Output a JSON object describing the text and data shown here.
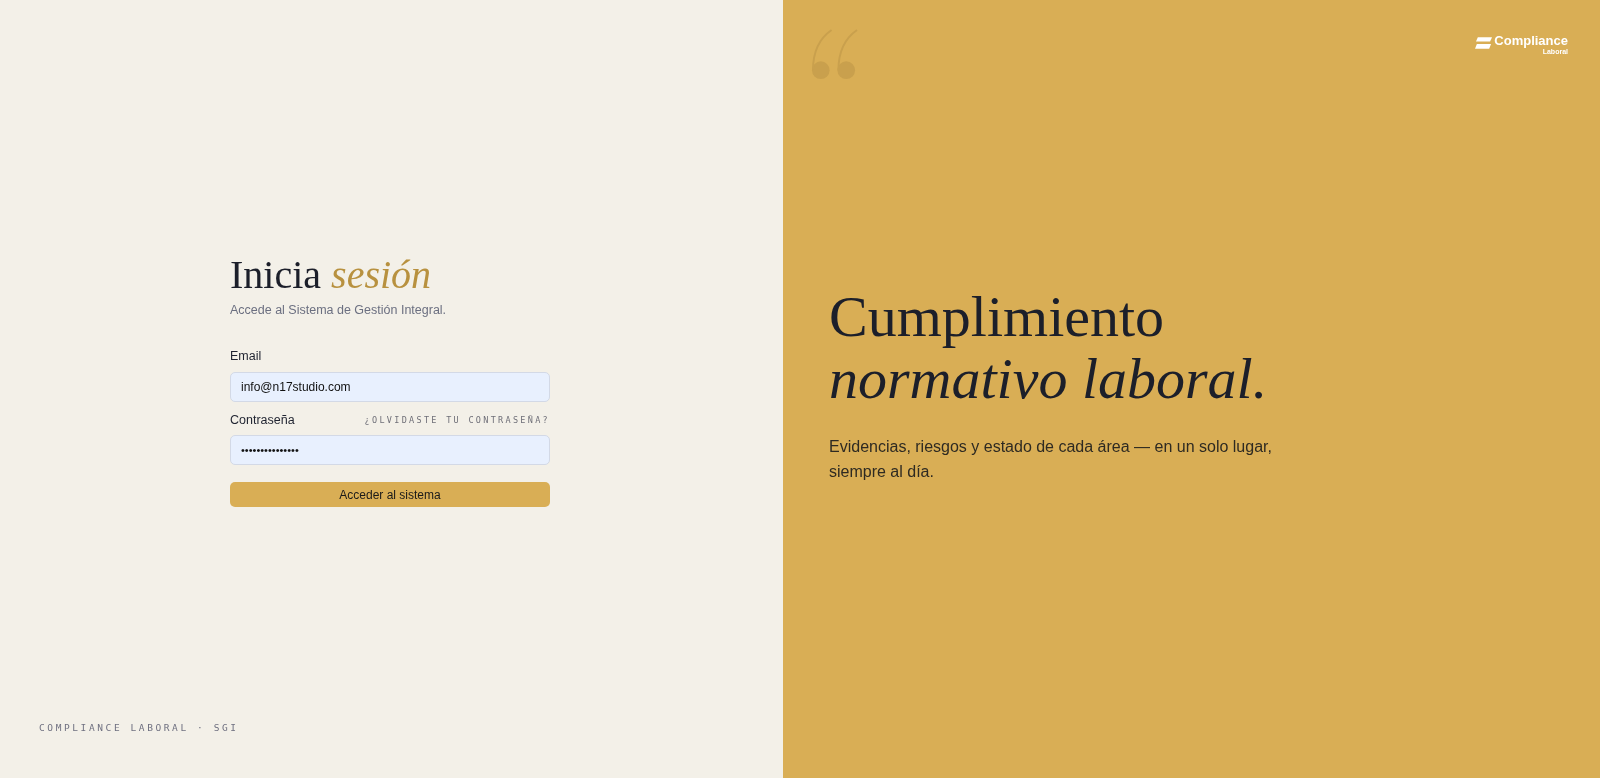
{
  "login": {
    "title": "Inicia *sesión*",
    "subtitle": "Accede al Sistema de Gestión Integral.",
    "email": {
      "label": "Email",
      "value": "info@n17studio.com"
    },
    "password": {
      "label": "Contraseña",
      "value": "•••••••••••••••",
      "forgot_link": "¿OLVIDASTE TU CONTRASEÑA?"
    },
    "submit_button": "Acceder al sistema"
  },
  "footer": "COMPLIANCE LABORAL · SGI",
  "hero": {
    "logo": {
      "name": "Compliance",
      "subtitle": "Laboral"
    },
    "heading": "Cumplimiento *normativo laboral.*",
    "description": "Evidencias, riesgos y estado de cada área — en un solo lugar, siempre al día."
  }
}
